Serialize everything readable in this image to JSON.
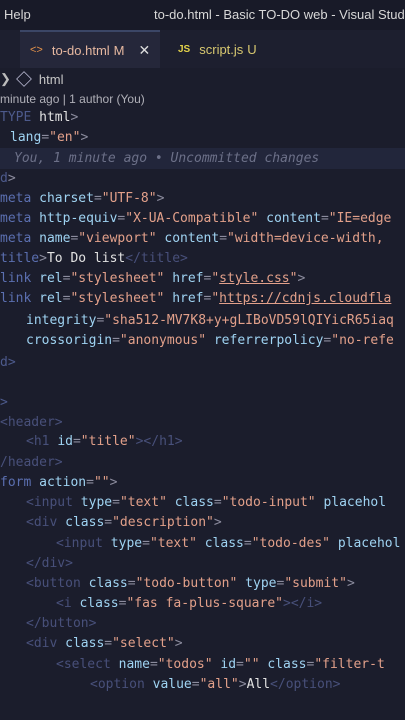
{
  "titlebar": {
    "menu": "Help",
    "window_title": "to-do.html - Basic TO-DO web - Visual Studio"
  },
  "tabs": [
    {
      "icon": "<>",
      "name": "to-do.html",
      "status": "M",
      "close": "✕"
    },
    {
      "icon": "JS",
      "name": "script.js",
      "status": "U"
    }
  ],
  "breadcrumb": {
    "chevron": "❯",
    "item": "html"
  },
  "codelens": "minute ago | 1 author (You)",
  "code": {
    "l1": [
      "TYPE",
      " ",
      "html",
      ">"
    ],
    "l2": [
      "lang",
      "=",
      "\"en\"",
      ">"
    ],
    "blame": "You, 1 minute ago • Uncommitted changes",
    "l4": [
      "d",
      ">"
    ],
    "l5": [
      "meta",
      " ",
      "charset",
      "=",
      "\"UTF-8\"",
      ">"
    ],
    "l6": [
      "meta",
      " ",
      "http-equiv",
      "=",
      "\"X-UA-Compatible\"",
      " ",
      "content",
      "=",
      "\"IE=edge"
    ],
    "l7": [
      "meta",
      " ",
      "name",
      "=",
      "\"viewport\"",
      " ",
      "content",
      "=",
      "\"width=device-width,"
    ],
    "l8": [
      "title",
      ">",
      "To Do list",
      "</title>"
    ],
    "l9": [
      "link",
      " ",
      "rel",
      "=",
      "\"stylesheet\"",
      " ",
      "href",
      "=",
      "\"",
      "style.css",
      "\"",
      ">"
    ],
    "l10": [
      "link",
      " ",
      "rel",
      "=",
      "\"stylesheet\"",
      " ",
      "href",
      "=",
      "\"",
      "https://cdnjs.cloudfla"
    ],
    "l11": [
      "integrity",
      "=",
      "\"sha512-MV7K8+y+gLIBoVD59lQIYicR65iaq"
    ],
    "l12": [
      "crossorigin",
      "=",
      "\"anonymous\"",
      " ",
      "referrerpolicy",
      "=",
      "\"no-refe"
    ],
    "l13": [
      "d>"
    ],
    "l14": [
      ">"
    ],
    "l15": [
      "<header>"
    ],
    "l16": [
      "<h1",
      " ",
      "id",
      "=",
      "\"title\"",
      "></h1>"
    ],
    "l17": [
      "/header>"
    ],
    "l18": [
      "form",
      " ",
      "action",
      "=",
      "\"\"",
      ">"
    ],
    "l19": [
      "<input",
      " ",
      "type",
      "=",
      "\"text\"",
      " ",
      "class",
      "=",
      "\"todo-input\"",
      " ",
      "placehol"
    ],
    "l20": [
      "<div",
      " ",
      "class",
      "=",
      "\"description\"",
      ">"
    ],
    "l21": [
      "<input",
      " ",
      "type",
      "=",
      "\"text\"",
      " ",
      "class",
      "=",
      "\"todo-des\"",
      " ",
      "placehol"
    ],
    "l22": [
      "</div>"
    ],
    "l23": [
      "<button",
      " ",
      "class",
      "=",
      "\"todo-button\"",
      " ",
      "type",
      "=",
      "\"submit\"",
      ">"
    ],
    "l24": [
      "<i",
      " ",
      "class",
      "=",
      "\"fas fa-plus-square\"",
      "></i>"
    ],
    "l25": [
      "</button>"
    ],
    "l26": [
      "<div",
      " ",
      "class",
      "=",
      "\"select\"",
      ">"
    ],
    "l27": [
      "<select",
      " ",
      "name",
      "=",
      "\"todos\"",
      " ",
      "id",
      "=",
      "\"\"",
      " ",
      "class",
      "=",
      "\"filter-t"
    ],
    "l28": [
      "<option",
      " ",
      "value",
      "=",
      "\"all\"",
      ">",
      "All",
      "</option>"
    ]
  }
}
